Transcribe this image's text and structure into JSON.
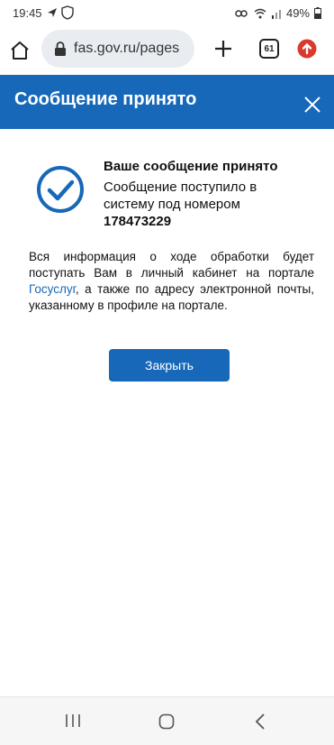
{
  "status_bar": {
    "time": "19:45",
    "battery": "49%",
    "icons": [
      "navigation-arrow-icon",
      "vpn-shield-icon",
      "key-icon",
      "wifi-icon",
      "signal-icon",
      "battery-icon"
    ]
  },
  "browser": {
    "url": "fas.gov.ru/pages",
    "tab_count": "61",
    "icons": [
      "home-icon",
      "lock-icon",
      "plus-icon",
      "tabs-icon",
      "update-icon"
    ]
  },
  "dialog": {
    "title": "Сообщение принято",
    "close_icon": "close-icon",
    "header_color": "#1768b8"
  },
  "message": {
    "icon": "check-circle-icon",
    "title": "Ваше сообщение принято",
    "line1": "Сообщение поступило в",
    "line2": "систему под номером",
    "number": "178473229"
  },
  "info": {
    "text_before": "Вся информация о ходе обработки будет поступать Вам в личный кабинет на портале ",
    "link": "Госуслуг",
    "text_after": ", а также по адресу электронной почты, указанному в профиле на портале."
  },
  "actions": {
    "close_label": "Закрыть"
  },
  "nav_bar": {
    "icons": [
      "recent-apps-icon",
      "home-button-icon",
      "back-icon"
    ]
  }
}
